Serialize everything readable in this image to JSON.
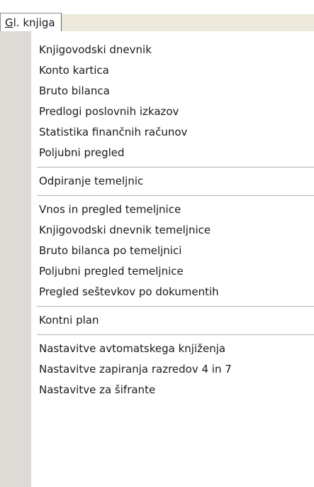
{
  "menu": {
    "title_accel": "G",
    "title_rest": "l. knjiga"
  },
  "groups": [
    [
      "Knjigovodski dnevnik",
      "Konto kartica",
      "Bruto bilanca",
      "Predlogi poslovnih izkazov",
      "Statistika finančnih računov",
      "Poljubni pregled"
    ],
    [
      "Odpiranje temeljnic"
    ],
    [
      "Vnos in pregled temeljnice",
      "Knjigovodski dnevnik temeljnice",
      "Bruto bilanca po temeljnici",
      "Poljubni pregled temeljnice",
      "Pregled seštevkov po dokumentih"
    ],
    [
      "Kontni plan"
    ],
    [
      "Nastavitve avtomatskega knjiženja",
      "Nastavitve zapiranja razredov 4 in 7",
      "Nastavitve za šifrante"
    ]
  ]
}
